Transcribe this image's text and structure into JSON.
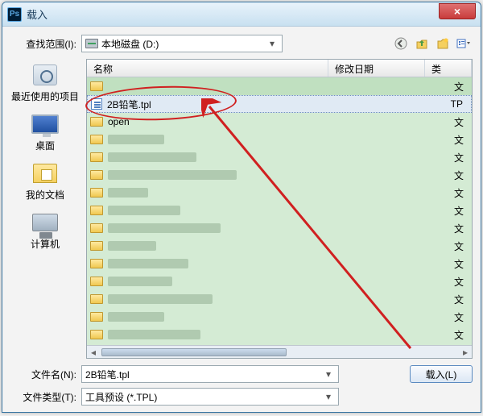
{
  "title": "载入",
  "lookup": {
    "label": "查找范围(I):",
    "value": "本地磁盘 (D:)"
  },
  "toolbar": {
    "back": "◀",
    "up": "up",
    "newFolder": "new",
    "views": "views"
  },
  "sidebar": [
    {
      "label": "最近使用的项目"
    },
    {
      "label": "桌面"
    },
    {
      "label": "我的文档"
    },
    {
      "label": "计算机"
    }
  ],
  "columns": {
    "name": "名称",
    "date": "修改日期",
    "type": "类"
  },
  "files": {
    "upRow": {
      "type": "文"
    },
    "selected": {
      "name": "2B铅笔.tpl",
      "type": "TP"
    },
    "open": {
      "name": "open",
      "type": "文"
    },
    "genericType": "文"
  },
  "fileNameLabel": "文件名(N):",
  "fileNameValue": "2B铅笔.tpl",
  "fileTypeLabel": "文件类型(T):",
  "fileTypeValue": "工具预设 (*.TPL)",
  "loadBtn": "载入(L)"
}
